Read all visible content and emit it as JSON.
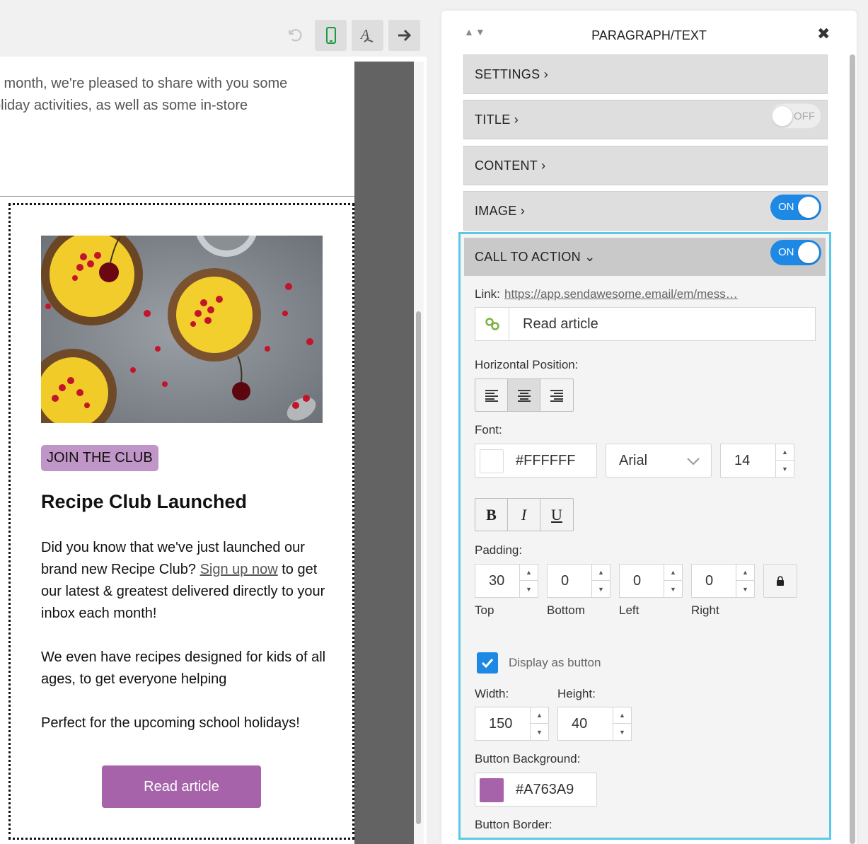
{
  "toolbar": {
    "undo_icon": "undo-icon",
    "mobile_icon": "mobile-icon",
    "spellcheck_icon": "spellcheck-icon",
    "next_icon": "arrow-right-icon"
  },
  "email": {
    "intro_line_1": "s month, we're pleased to share with you some",
    "intro_line_2": "oliday activities, as well as some in-store",
    "pill": "JOIN THE CLUB",
    "title": "Recipe Club Launched",
    "para1_before": "Did you know that we've just launched our brand new Recipe Club? ",
    "para1_link": "Sign up now",
    "para1_after": " to get our latest & greatest delivered directly to your inbox each month!",
    "para2": "We even have recipes designed for kids of all ages, to get everyone helping",
    "para3": "Perfect for the upcoming school holidays!",
    "button": "Read article",
    "button_color": "#A763A9",
    "pill_color": "#C095C8"
  },
  "panel": {
    "title": "PARAGRAPH/TEXT",
    "sections": {
      "settings": "SETTINGS ›",
      "title": "TITLE ›",
      "title_toggle": "OFF",
      "content": "CONTENT ›",
      "image": "IMAGE ›",
      "image_toggle": "ON",
      "cta": "CALL TO ACTION ⌄",
      "cta_toggle": "ON"
    },
    "cta": {
      "link_label": "Link:",
      "link_url": "https://app.sendawesome.email/em/mess…",
      "link_text_value": "Read article",
      "hpos_label": "Horizontal Position:",
      "font_label": "Font:",
      "font_color": "#FFFFFF",
      "font_family": "Arial",
      "font_size": "14",
      "bold": "B",
      "italic": "I",
      "underline": "U",
      "padding_label": "Padding:",
      "padding_top": "30",
      "padding_bottom": "0",
      "padding_left": "0",
      "padding_right": "0",
      "top_label": "Top",
      "bottom_label": "Bottom",
      "left_label": "Left",
      "right_label": "Right",
      "display_button_label": "Display as button",
      "width_label": "Width:",
      "height_label": "Height:",
      "width_value": "150",
      "height_value": "40",
      "bg_label": "Button Background:",
      "bg_value": "#A763A9",
      "border_label": "Button Border:"
    },
    "accent": "#1E88E5",
    "highlight": "#5BC8E8"
  }
}
